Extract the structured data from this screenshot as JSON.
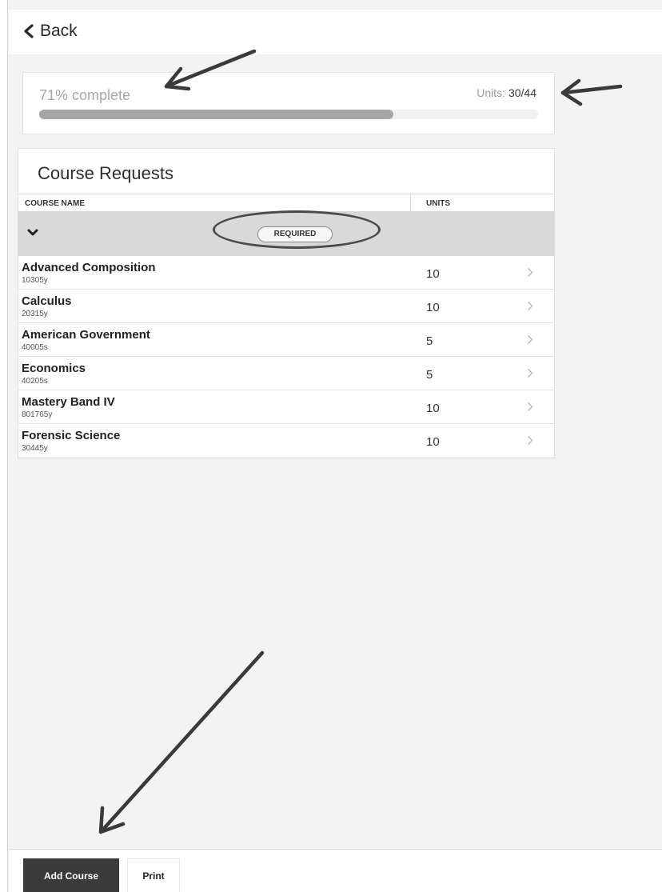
{
  "header": {
    "back_label": "Back"
  },
  "progress": {
    "percent_label": "71% complete",
    "percent_value": 0.71,
    "units_label": "Units:",
    "units_value": "30/44"
  },
  "course_requests": {
    "title": "Course Requests",
    "columns": {
      "name": "COURSE NAME",
      "units": "UNITS"
    },
    "group_badge": "REQUIRED",
    "courses": [
      {
        "name": "Advanced Composition",
        "code": "10305y",
        "units": "10"
      },
      {
        "name": "Calculus",
        "code": "20315y",
        "units": "10"
      },
      {
        "name": "American Government",
        "code": "40005s",
        "units": "5"
      },
      {
        "name": "Economics",
        "code": "40205s",
        "units": "5"
      },
      {
        "name": "Mastery Band IV",
        "code": "801765y",
        "units": "10"
      },
      {
        "name": "Forensic Science",
        "code": "30445y",
        "units": "10"
      }
    ]
  },
  "footer": {
    "add_course_label": "Add Course",
    "print_label": "Print"
  },
  "colors": {
    "progress_fill": "#a6a6a6",
    "group_row_bg": "#d9d9d9",
    "primary_button_bg": "#3a3a3a"
  },
  "icons": {
    "back": "chevron-left-icon",
    "group_toggle": "chevron-down-icon",
    "row_open": "chevron-right-icon"
  }
}
